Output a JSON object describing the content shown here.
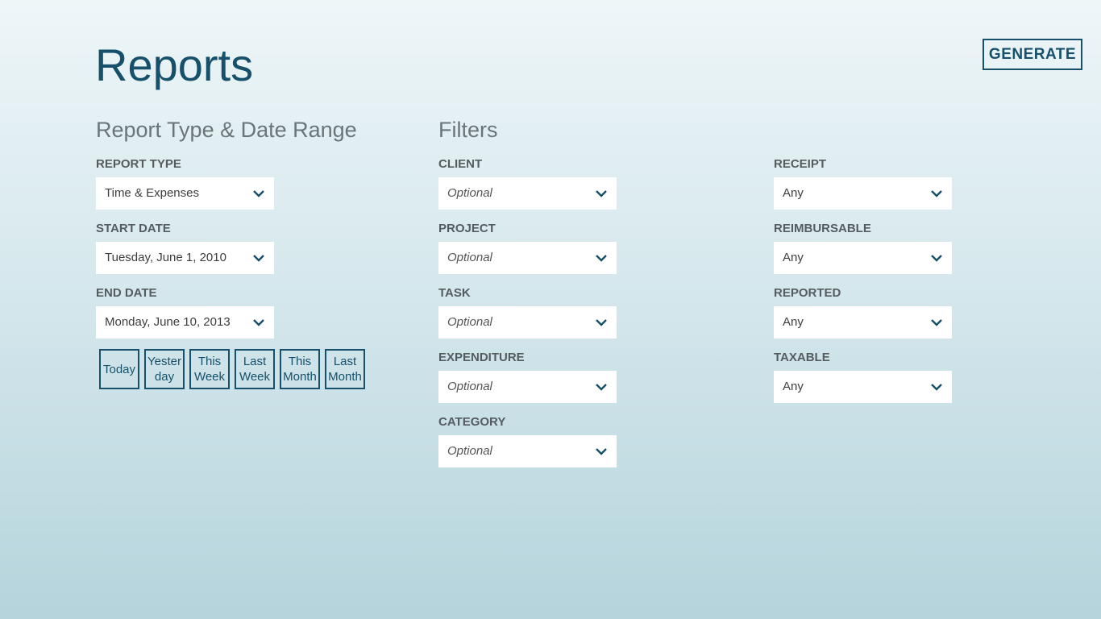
{
  "header": {
    "title": "Reports",
    "generate_label": "GENERATE"
  },
  "report_section": {
    "heading": "Report Type & Date Range",
    "report_type": {
      "label": "REPORT TYPE",
      "value": "Time & Expenses"
    },
    "start_date": {
      "label": "START DATE",
      "value": "Tuesday, June 1, 2010"
    },
    "end_date": {
      "label": "END DATE",
      "value": "Monday, June 10, 2013"
    },
    "quick_ranges": [
      "Today",
      "Yester\nday",
      "This\nWeek",
      "Last\nWeek",
      "This\nMonth",
      "Last\nMonth"
    ]
  },
  "filters": {
    "heading": "Filters",
    "client": {
      "label": "CLIENT",
      "value": "Optional"
    },
    "project": {
      "label": "PROJECT",
      "value": "Optional"
    },
    "task": {
      "label": "TASK",
      "value": "Optional"
    },
    "expenditure": {
      "label": "EXPENDITURE",
      "value": "Optional"
    },
    "category": {
      "label": "CATEGORY",
      "value": "Optional"
    },
    "receipt": {
      "label": "RECEIPT",
      "value": "Any"
    },
    "reimbursable": {
      "label": "REIMBURSABLE",
      "value": "Any"
    },
    "reported": {
      "label": "REPORTED",
      "value": "Any"
    },
    "taxable": {
      "label": "TAXABLE",
      "value": "Any"
    }
  },
  "icons": {
    "dropdown": "chevron-down-icon"
  },
  "colors": {
    "accent": "#16506a",
    "background_top": "#eef6f8",
    "background_bottom": "#b5d4dc",
    "field_background": "#ffffff"
  }
}
